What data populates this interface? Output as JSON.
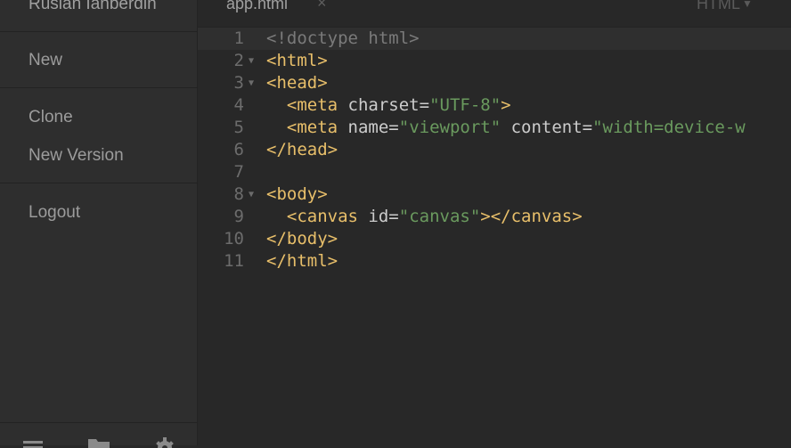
{
  "sidebar": {
    "user_name": "Ruslan Ianberdin",
    "items": [
      {
        "label": "New"
      },
      {
        "label": "Clone"
      },
      {
        "label": "New Version"
      },
      {
        "label": "Logout"
      }
    ],
    "footer_icons": [
      "menu-icon",
      "folder-icon",
      "gear-icon"
    ]
  },
  "editor": {
    "tab": {
      "label": "app.html",
      "close": "×"
    },
    "language": "HTML",
    "lines": [
      {
        "num": "1",
        "foldable": false,
        "tokens": [
          {
            "t": "<!doctype html>",
            "c": "doctype"
          }
        ]
      },
      {
        "num": "2",
        "foldable": true,
        "tokens": [
          {
            "t": "<html>",
            "c": "tag"
          }
        ]
      },
      {
        "num": "3",
        "foldable": true,
        "tokens": [
          {
            "t": "<head>",
            "c": "tag"
          }
        ]
      },
      {
        "num": "4",
        "foldable": false,
        "tokens": [
          {
            "t": "  ",
            "c": ""
          },
          {
            "t": "<meta",
            "c": "tag"
          },
          {
            "t": " charset",
            "c": "attr"
          },
          {
            "t": "=",
            "c": "attr"
          },
          {
            "t": "\"UTF-8\"",
            "c": "str"
          },
          {
            "t": ">",
            "c": "tag"
          }
        ]
      },
      {
        "num": "5",
        "foldable": false,
        "tokens": [
          {
            "t": "  ",
            "c": ""
          },
          {
            "t": "<meta",
            "c": "tag"
          },
          {
            "t": " name",
            "c": "attr"
          },
          {
            "t": "=",
            "c": "attr"
          },
          {
            "t": "\"viewport\"",
            "c": "str"
          },
          {
            "t": " content",
            "c": "attr"
          },
          {
            "t": "=",
            "c": "attr"
          },
          {
            "t": "\"width=device-w",
            "c": "str"
          }
        ]
      },
      {
        "num": "6",
        "foldable": false,
        "tokens": [
          {
            "t": "</head>",
            "c": "tag"
          }
        ]
      },
      {
        "num": "7",
        "foldable": false,
        "tokens": []
      },
      {
        "num": "8",
        "foldable": true,
        "tokens": [
          {
            "t": "<body>",
            "c": "tag"
          }
        ]
      },
      {
        "num": "9",
        "foldable": false,
        "tokens": [
          {
            "t": "  ",
            "c": ""
          },
          {
            "t": "<canvas",
            "c": "tag"
          },
          {
            "t": " id",
            "c": "attr"
          },
          {
            "t": "=",
            "c": "attr"
          },
          {
            "t": "\"canvas\"",
            "c": "str"
          },
          {
            "t": "></canvas>",
            "c": "tag"
          }
        ]
      },
      {
        "num": "10",
        "foldable": false,
        "tokens": [
          {
            "t": "</body>",
            "c": "tag"
          }
        ]
      },
      {
        "num": "11",
        "foldable": false,
        "tokens": [
          {
            "t": "</html>",
            "c": "tag"
          }
        ]
      }
    ]
  },
  "colors": {
    "background": "#282828",
    "sidebar": "#2e2e2e",
    "tag": "#e8bf6a",
    "string": "#6a9a5e",
    "attribute": "#cccccc",
    "line_number": "#6c6c6c"
  }
}
